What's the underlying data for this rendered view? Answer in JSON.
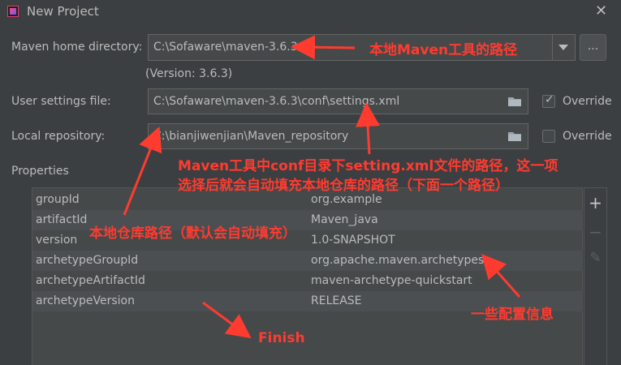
{
  "window": {
    "title": "New Project",
    "close_glyph": "✕"
  },
  "maven_home": {
    "label": "Maven home directory:",
    "value": "C:\\Sofaware\\maven-3.6.3",
    "version": "(Version: 3.6.3)",
    "browse_label": "..."
  },
  "settings_file": {
    "label": "User settings file:",
    "value": "C:\\Sofaware\\maven-3.6.3\\conf\\settings.xml",
    "override_label": "Override",
    "override_checked": true
  },
  "local_repo": {
    "label": "Local repository:",
    "value": "C:\\bianjiwenjian\\Maven_repository",
    "override_label": "Override",
    "override_checked": false
  },
  "properties": {
    "label": "Properties",
    "rows": [
      {
        "key": "groupId",
        "value": "org.example"
      },
      {
        "key": "artifactId",
        "value": "Maven_java"
      },
      {
        "key": "version",
        "value": "1.0-SNAPSHOT"
      },
      {
        "key": "archetypeGroupId",
        "value": "org.apache.maven.archetypes"
      },
      {
        "key": "archetypeArtifactId",
        "value": "maven-archetype-quickstart"
      },
      {
        "key": "archetypeVersion",
        "value": "RELEASE"
      }
    ],
    "toolbar": {
      "add": "+",
      "remove": "−",
      "edit": "✎"
    }
  },
  "annotations": {
    "maven_path": "本地Maven工具的路径",
    "settings_line1": "Maven工具中conf目录下setting.xml文件的路径，这一项",
    "settings_line2": "选择后就会自动填充本地仓库的路径（下面一个路径）",
    "local_repo": "本地仓库路径（默认会自动填充）",
    "config_info": "一些配置信息",
    "finish": "Finish"
  },
  "colors": {
    "background": "#3c3f41",
    "field": "#45494a",
    "annotation": "#ff3b30"
  }
}
